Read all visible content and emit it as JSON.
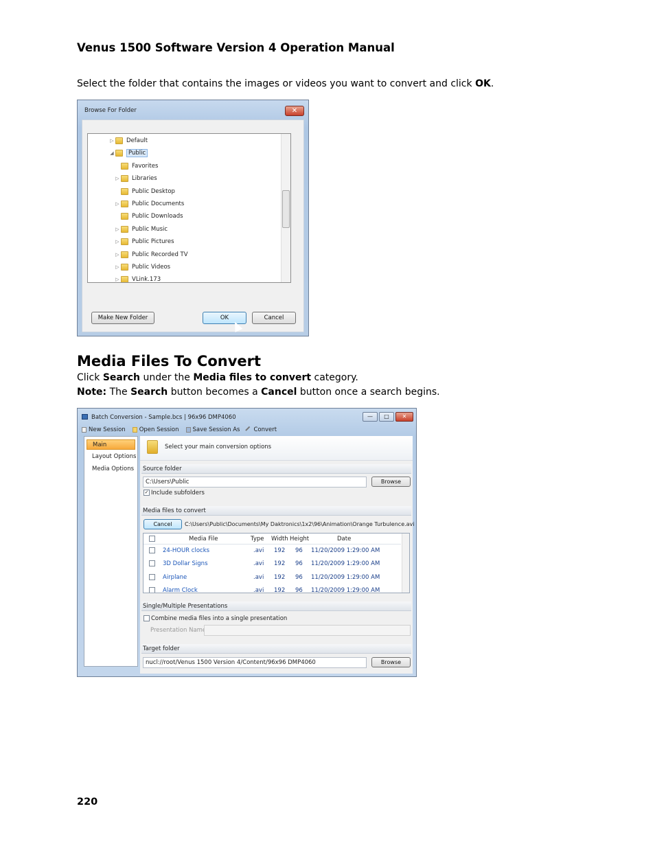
{
  "doc": {
    "header": "Venus 1500 Software Version 4 Operation Manual",
    "para1": {
      "pre": "Select the folder that contains the images or videos you want to convert and click ",
      "ok": "OK",
      "post": "."
    },
    "section_title": "Media Files To Convert",
    "para2": {
      "pre": "Click ",
      "b1": "Search",
      "mid": " under the ",
      "b2": "Media files to convert",
      "post": " category."
    },
    "para3": {
      "note": "Note:",
      "t1": " The ",
      "b1": "Search",
      "t2": " button becomes a ",
      "b2": "Cancel",
      "t3": " button once a search begins."
    },
    "page_number": "220"
  },
  "browse_dialog": {
    "title": "Browse For Folder",
    "close_glyph": "✕",
    "tree": [
      {
        "label": "Default",
        "level": 0,
        "expander": "▷",
        "selected": false
      },
      {
        "label": "Public",
        "level": 0,
        "expander": "◢",
        "selected": true
      },
      {
        "label": "Favorites",
        "level": 1,
        "expander": "",
        "selected": false
      },
      {
        "label": "Libraries",
        "level": 1,
        "expander": "▷",
        "selected": false
      },
      {
        "label": "Public Desktop",
        "level": 1,
        "expander": "",
        "selected": false
      },
      {
        "label": "Public Documents",
        "level": 1,
        "expander": "▷",
        "selected": false
      },
      {
        "label": "Public Downloads",
        "level": 1,
        "expander": "",
        "selected": false
      },
      {
        "label": "Public Music",
        "level": 1,
        "expander": "▷",
        "selected": false
      },
      {
        "label": "Public Pictures",
        "level": 1,
        "expander": "▷",
        "selected": false
      },
      {
        "label": "Public Recorded TV",
        "level": 1,
        "expander": "▷",
        "selected": false
      },
      {
        "label": "Public Videos",
        "level": 1,
        "expander": "▷",
        "selected": false
      },
      {
        "label": "VLink.173",
        "level": 1,
        "expander": "▷",
        "selected": false
      }
    ],
    "buttons": {
      "make_new_folder": "Make New Folder",
      "ok": "OK",
      "cancel": "Cancel"
    }
  },
  "batch_window": {
    "title": "Batch Conversion - Sample.bcs | 96x96 DMP4060",
    "window_buttons": {
      "minimize": "—",
      "maximize": "□",
      "close": "✕"
    },
    "toolbar": [
      "New Session",
      "Open Session",
      "Save Session As",
      "Convert"
    ],
    "nav": [
      "Main",
      "Layout Options",
      "Media Options"
    ],
    "banner_text": "Select your main conversion options",
    "source_folder": {
      "label": "Source folder",
      "value": "C:\\Users\\Public",
      "browse": "Browse",
      "include_subfolders": "Include subfolders",
      "include_checked": "✓"
    },
    "media": {
      "label": "Media files to convert",
      "cancel": "Cancel",
      "current_path": "C:\\Users\\Public\\Documents\\My Daktronics\\1x2\\96\\Animation\\Orange Turbulence.avi",
      "columns": [
        "Media File",
        "Type",
        "Width",
        "Height",
        "Date"
      ],
      "rows": [
        {
          "name": "24-HOUR clocks",
          "type": ".avi",
          "width": "192",
          "height": "96",
          "date": "11/20/2009 1:29:00 AM"
        },
        {
          "name": "3D Dollar Signs",
          "type": ".avi",
          "width": "192",
          "height": "96",
          "date": "11/20/2009 1:29:00 AM"
        },
        {
          "name": "Airplane",
          "type": ".avi",
          "width": "192",
          "height": "96",
          "date": "11/20/2009 1:29:00 AM"
        },
        {
          "name": "Alarm Clock",
          "type": ".avi",
          "width": "192",
          "height": "96",
          "date": "11/20/2009 1:29:00 AM"
        }
      ]
    },
    "presentations": {
      "label": "Single/Multiple Presentations",
      "combine": "Combine media files into a single presentation",
      "presentation_name": "Presentation Name"
    },
    "target_folder": {
      "label": "Target folder",
      "value": "nucl://root/Venus 1500 Version 4/Content/96x96 DMP4060",
      "browse": "Browse"
    }
  }
}
